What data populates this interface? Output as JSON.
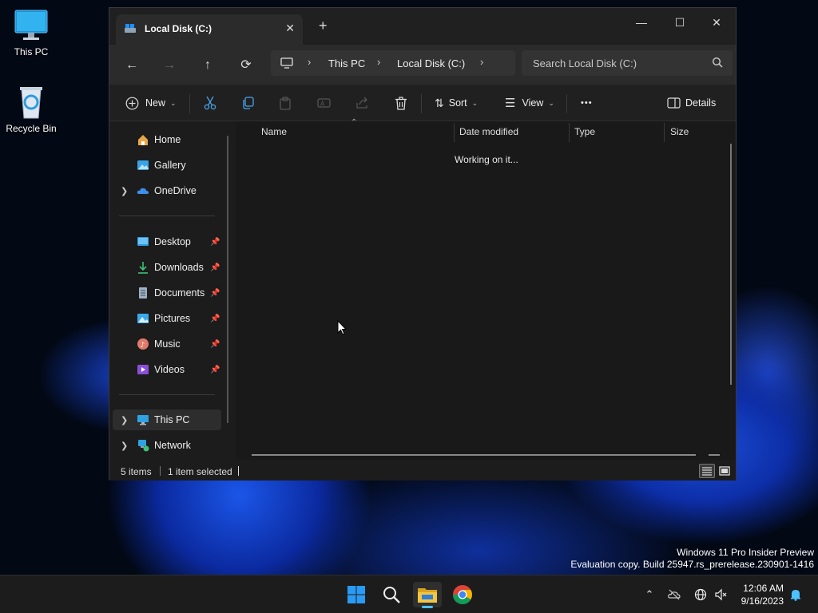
{
  "desktop": {
    "icons": [
      {
        "label": "This PC"
      },
      {
        "label": "Recycle Bin"
      }
    ],
    "watermark": {
      "line1": "Windows 11 Pro Insider Preview",
      "line2": "Evaluation copy. Build 25947.rs_prerelease.230901-1416"
    }
  },
  "window": {
    "tab_title": "Local Disk (C:)",
    "tab_close": "✕",
    "new_tab": "+",
    "controls": {
      "minimize": "—",
      "maximize": "☐",
      "close": "✕"
    },
    "nav": {
      "back": "←",
      "forward": "→",
      "up": "↑",
      "refresh": "⟳"
    },
    "breadcrumb": [
      "This PC",
      "Local Disk (C:)"
    ],
    "search_placeholder": "Search Local Disk (C:)",
    "toolbar": {
      "new_label": "New",
      "sort_label": "Sort",
      "view_label": "View",
      "more_label": "•••",
      "details_label": "Details"
    },
    "sidebar": {
      "items": [
        {
          "label": "Home",
          "icon": "home-icon"
        },
        {
          "label": "Gallery",
          "icon": "gallery-icon"
        },
        {
          "label": "OneDrive",
          "icon": "onedrive-icon"
        },
        {
          "label": "Desktop",
          "icon": "desktop-folder-icon"
        },
        {
          "label": "Downloads",
          "icon": "downloads-icon"
        },
        {
          "label": "Documents",
          "icon": "documents-icon"
        },
        {
          "label": "Pictures",
          "icon": "pictures-icon"
        },
        {
          "label": "Music",
          "icon": "music-icon"
        },
        {
          "label": "Videos",
          "icon": "videos-icon"
        },
        {
          "label": "This PC",
          "icon": "this-pc-icon"
        },
        {
          "label": "Network",
          "icon": "network-icon"
        }
      ],
      "selected": "This PC"
    },
    "columns": [
      "Name",
      "Date modified",
      "Type",
      "Size"
    ],
    "status_message": "Working on it...",
    "statusbar": {
      "items_count": "5 items",
      "selection": "1 item selected"
    }
  },
  "taskbar": {
    "apps": [
      "start-icon",
      "search-icon",
      "file-explorer-icon",
      "chrome-icon"
    ],
    "clock": {
      "time": "12:06 AM",
      "date": "9/16/2023"
    },
    "colors": {
      "accent": "#0078d4",
      "explorer_folder": "#f4c542"
    }
  }
}
